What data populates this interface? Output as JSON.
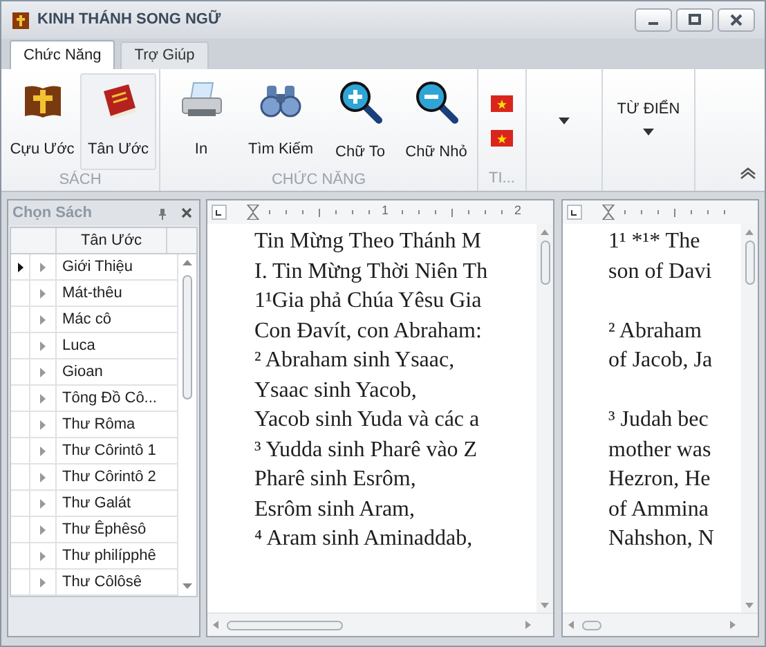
{
  "window": {
    "title": "KINH THÁNH SONG NGỮ"
  },
  "tabs": [
    {
      "label": "Chức Năng",
      "selected": true
    },
    {
      "label": "Trợ Giúp",
      "selected": false
    }
  ],
  "ribbon": {
    "groups": [
      {
        "label": "SÁCH",
        "buttons": [
          {
            "kind": "book",
            "label": "Cựu Ước",
            "selected": false
          },
          {
            "kind": "redbook",
            "label": "Tân Ước",
            "selected": true
          }
        ]
      },
      {
        "label": "CHỨC NĂNG",
        "buttons": [
          {
            "kind": "printer",
            "label": "In",
            "selected": false
          },
          {
            "kind": "binoculars",
            "label": "Tìm Kiếm",
            "selected": false
          },
          {
            "kind": "zoomin",
            "label": "Chữ To",
            "selected": false
          },
          {
            "kind": "zoomout",
            "label": "Chữ Nhỏ",
            "selected": false
          }
        ]
      },
      {
        "label": "TI...",
        "buttons": [
          {
            "kind": "flag"
          },
          {
            "kind": "flag"
          }
        ]
      },
      {
        "buttons": [
          {
            "kind": "dropdown"
          }
        ]
      },
      {
        "buttons": [
          {
            "kind": "dropdown",
            "label": "TỪ ĐIỂN"
          }
        ]
      }
    ]
  },
  "book_panel": {
    "title": "Chọn Sách",
    "column": "Tân Ước",
    "rows": [
      {
        "name": "Giới Thiệu",
        "selected": true
      },
      {
        "name": "Mát-thêu",
        "selected": false
      },
      {
        "name": "Mác cô",
        "selected": false
      },
      {
        "name": "Luca",
        "selected": false
      },
      {
        "name": "Gioan",
        "selected": false
      },
      {
        "name": "Tông Đồ Cô...",
        "selected": false
      },
      {
        "name": "Thư Rôma",
        "selected": false
      },
      {
        "name": "Thư Côrintô 1",
        "selected": false
      },
      {
        "name": "Thư Côrintô 2",
        "selected": false
      },
      {
        "name": "Thư Galát",
        "selected": false
      },
      {
        "name": "Thư Êphêsô",
        "selected": false
      },
      {
        "name": "Thư philípphê",
        "selected": false
      },
      {
        "name": "Thư Côlôsê",
        "selected": false
      }
    ]
  },
  "documents": [
    {
      "ruler_labels": [
        "1",
        "2"
      ],
      "paragraphs": [
        [
          "Tin Mừng Theo Thánh M",
          "I. Tin Mừng Thời Niên Th",
          "1¹Gia phả Chúa Yêsu  Gia",
          "Con Đavít, con Abraham:",
          "² Abraham sinh Ysaac,",
          "Ysaac sinh Yacob,",
          "Yacob sinh Yuda và các a",
          "³ Yudda sinh Pharê vào Z",
          "Pharê sinh Esrôm,",
          "Esrôm sinh Aram,",
          "⁴ Aram sinh Aminaddab,"
        ]
      ]
    },
    {
      "paragraphs": [
        [
          "1¹ *¹* The",
          "son of Davi"
        ],
        [
          "² Abraham",
          "of Jacob, Ja"
        ],
        [
          "³ Judah bec",
          "mother was",
          "Hezron, He",
          "of Ammina",
          "Nahshon, N"
        ]
      ]
    }
  ]
}
